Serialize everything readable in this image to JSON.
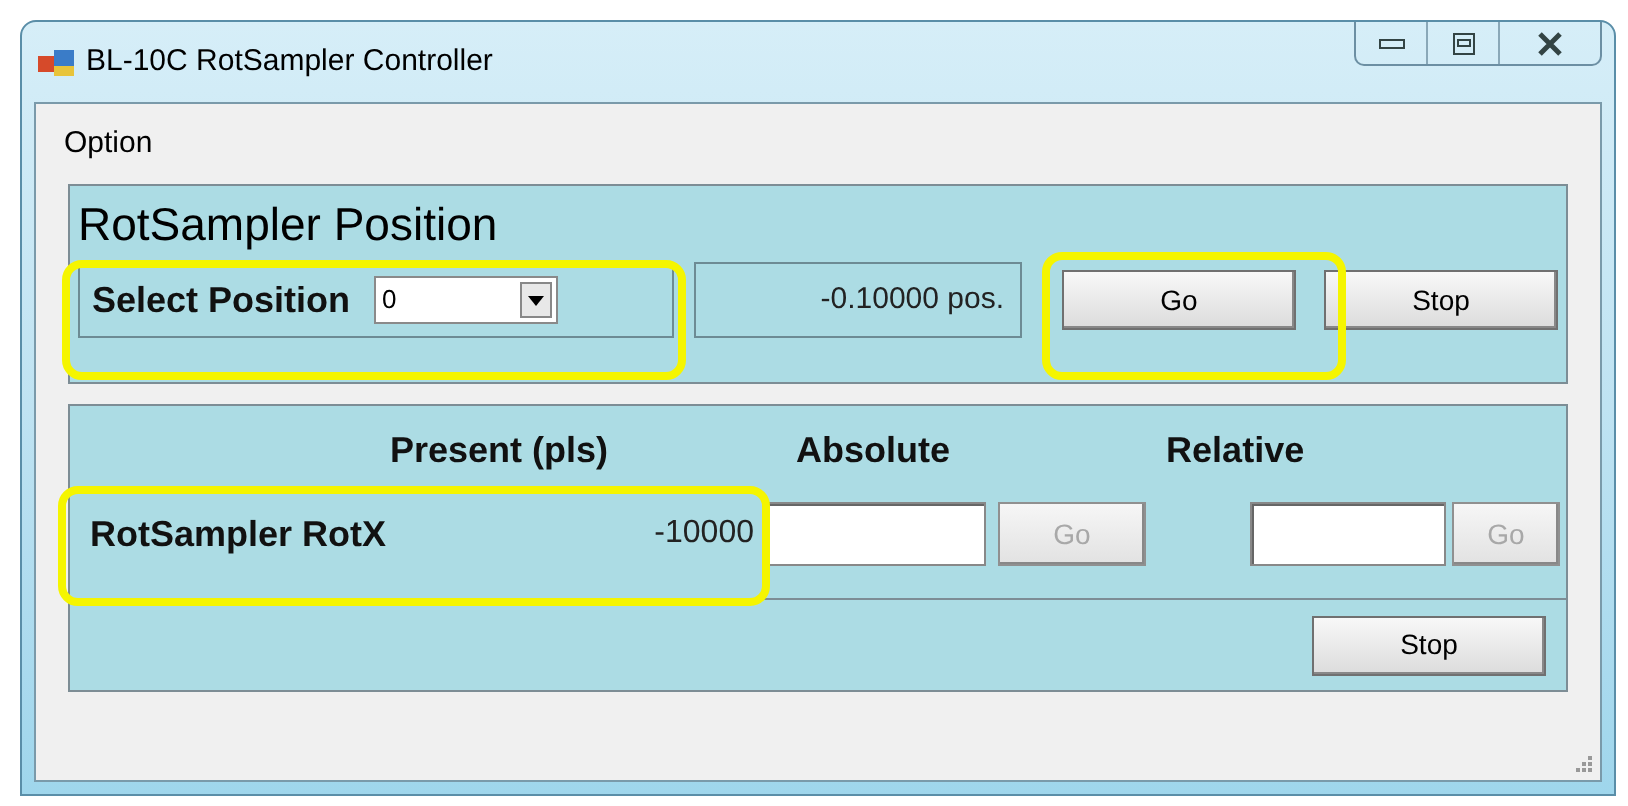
{
  "window": {
    "title": "BL-10C RotSampler Controller"
  },
  "menu": [
    {
      "label": "Option"
    }
  ],
  "position_panel": {
    "title": "RotSampler Position",
    "select_label": "Select Position",
    "select_value": "0",
    "reading": "-0.10000 pos.",
    "buttons": [
      {
        "label": "Go",
        "disabled": false
      },
      {
        "label": "Stop",
        "disabled": false
      }
    ]
  },
  "axes_panel": {
    "headers": [
      "Present (pls)",
      "Absolute",
      "Relative"
    ],
    "rows": [
      {
        "name": "RotSampler RotX",
        "present": "-10000",
        "absolute_go": {
          "label": "Go",
          "disabled": true
        },
        "relative_go": {
          "label": "Go",
          "disabled": true
        }
      }
    ]
  },
  "stop_button": {
    "label": "Stop",
    "disabled": false
  }
}
